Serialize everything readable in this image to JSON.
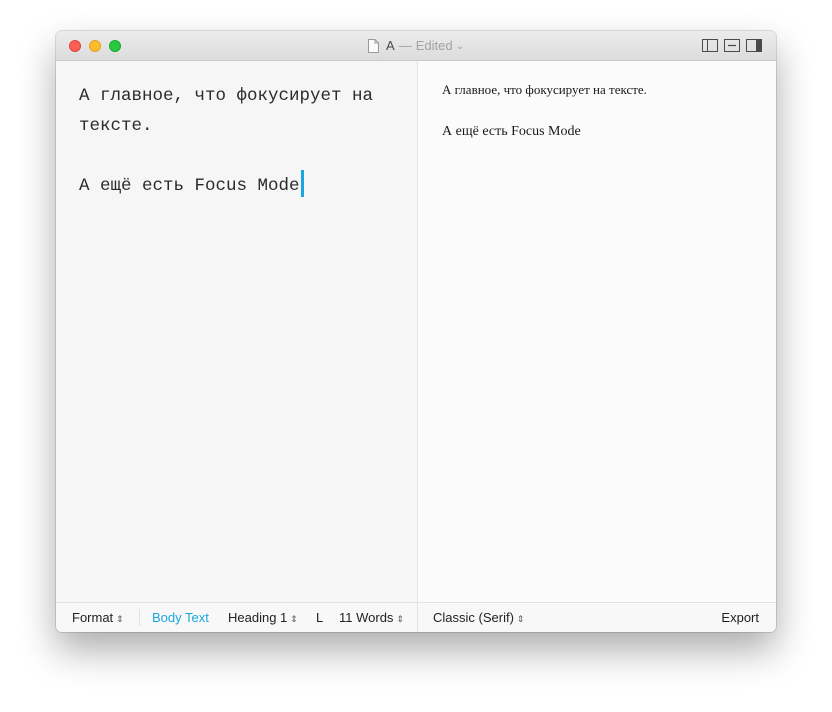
{
  "window": {
    "title": "A",
    "title_separator": "—",
    "status": "Edited",
    "title_chevron": "⌄"
  },
  "editor": {
    "paragraphs": [
      "А главное, что фокусирует на тексте.",
      "А ещё есть Focus Mode"
    ]
  },
  "preview": {
    "paragraphs": [
      "А главное, что фокусирует на тексте.",
      "А ещё есть Focus Mode"
    ]
  },
  "statusbar": {
    "format_label": "Format",
    "body_text_label": "Body Text",
    "heading_label": "Heading 1",
    "l_label": "L",
    "words_label": "11 Words",
    "template_label": "Classic (Serif)",
    "export_label": "Export",
    "updown_glyph": "⇕"
  },
  "colors": {
    "accent": "#1aa7e0",
    "close": "#fd5f57",
    "minimize": "#febc2e",
    "maximize": "#28c840"
  },
  "icons": {
    "document": "document-icon",
    "sidebar_left": "sidebar-left-icon",
    "split": "split-view-icon",
    "sidebar_right": "sidebar-right-icon"
  }
}
